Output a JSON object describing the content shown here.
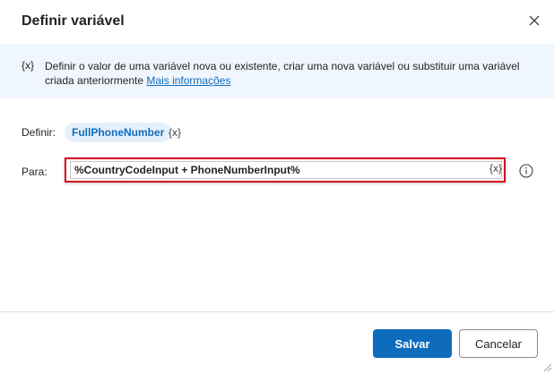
{
  "dialog": {
    "title": "Definir variável",
    "close_icon": "close-icon"
  },
  "banner": {
    "icon_text": "{x}",
    "description": "Definir o valor de uma variável nova ou existente, criar uma nova variável ou substituir uma variável criada anteriormente",
    "link_text": "Mais informações"
  },
  "form": {
    "set_label": "Definir:",
    "variable_name": "FullPhoneNumber",
    "variable_icon": "{x}",
    "to_label": "Para:",
    "value": "%CountryCodeInput + PhoneNumberInput%",
    "value_icon": "{x}",
    "info_icon": "info-icon"
  },
  "footer": {
    "save_label": "Salvar",
    "cancel_label": "Cancelar"
  },
  "colors": {
    "accent": "#0f6cbd",
    "banner_bg": "#f0f6fd",
    "highlight_border": "#d6001c"
  }
}
